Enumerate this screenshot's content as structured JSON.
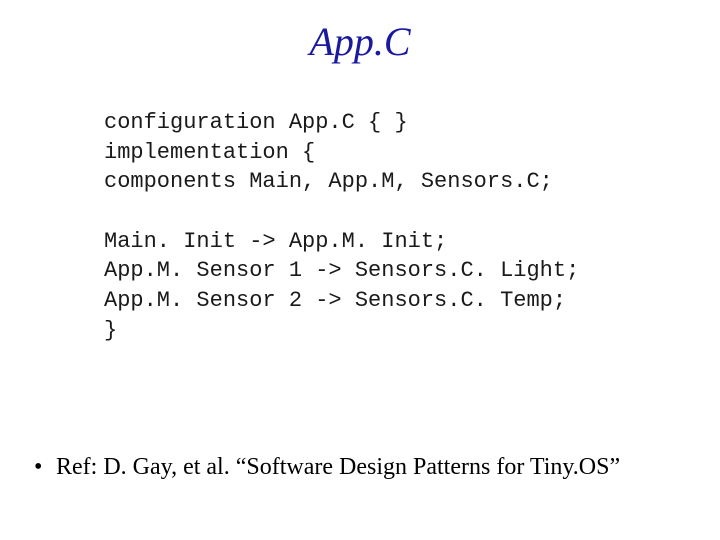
{
  "title": "App.C",
  "code": {
    "l1": "configuration App.C { }",
    "l2": "implementation {",
    "l3": "components Main, App.M, Sensors.C;",
    "l4": "",
    "l5": "Main. Init -> App.M. Init;",
    "l6": "App.M. Sensor 1 -> Sensors.C. Light;",
    "l7": "App.M. Sensor 2 -> Sensors.C. Temp;",
    "l8": "}"
  },
  "ref": {
    "bullet": "•",
    "text": "Ref: D. Gay, et al. “Software Design Patterns for Tiny.OS”"
  }
}
